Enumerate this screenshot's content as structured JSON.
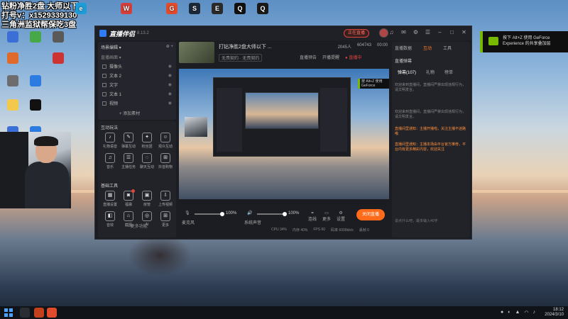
{
  "overlay": {
    "line1": "钻粉净胜2盘 大师以下",
    "line2": "打号v：x1529339130",
    "line3": "三角洲监狱帮保吃3盘"
  },
  "desktop_icons": [
    {
      "label": "Microsoft Edge",
      "color": "#1e9bd7",
      "glyph": "e"
    },
    {
      "label": "WPS",
      "color": "#d43f3a",
      "glyph": "W"
    },
    {
      "label": "Steam",
      "color": "#1b2838",
      "glyph": "S"
    },
    {
      "label": "Epic",
      "color": "#2a2a2a",
      "glyph": "E"
    },
    {
      "label": "QQ",
      "color": "#111111",
      "glyph": "Q"
    },
    {
      "label": "QQ",
      "color": "#1a1a1a",
      "glyph": "Q"
    }
  ],
  "app": {
    "name": "直播伴侣",
    "version": "8.13.2",
    "live_badge": "正在直播",
    "scenes": {
      "header": "场景编辑 ▾",
      "header_right": "⊕ +",
      "sub": "直播画面 ▾",
      "items": [
        "摄像头",
        "文本 2",
        "文字",
        "文本 1",
        "视频"
      ],
      "add_label": "+ 添加素材"
    },
    "interaction": {
      "title": "互动玩法",
      "tools": [
        "礼物语音",
        "弹幕互动",
        "粉丝团",
        "观众互动",
        "音乐",
        "主播任务",
        "聊天互动",
        "抖音购物"
      ]
    },
    "basic_tools": {
      "title": "基础工具",
      "tools": [
        "直播设置",
        "福袋",
        "房管",
        "上传视频",
        "音效",
        "截图",
        "AI",
        "更多"
      ],
      "more": "··· 更多功能"
    },
    "stream": {
      "title": "打钻净胜2盘大师以下 ...",
      "category": "无畏契约 · 无畏契约",
      "actions": [
        "直播预告",
        "开播提醒",
        "● 直播中"
      ],
      "stats": [
        "2045人",
        "604743",
        "00:00"
      ]
    },
    "notif": "按 Alt+Z 使用 GeForce",
    "controls": {
      "mic_label": "麦克风",
      "mic_pct": "100%",
      "sys_label": "系统声音",
      "sys_pct": "100%",
      "btn_labels": [
        "连线",
        "更多",
        "设置"
      ],
      "start_label": "关闭直播",
      "status": [
        "CPU 34%",
        "内存 40%",
        "FPS 60",
        "码率 6000kb/s",
        "丢帧 0"
      ]
    },
    "right": {
      "tabs": [
        "直播数据",
        "互动",
        "工具"
      ],
      "chat_head": "直播弹幕",
      "chat_tabs": [
        "弹幕(107)",
        "礼物",
        "榜单"
      ],
      "messages": [
        {
          "text": "欢迎来到直播间，直播间严禁出现违规行为，请文明发言。",
          "hl": false
        },
        {
          "text": "欢迎来到直播间，直播间严禁出现违规行为，请文明发言。",
          "hl": false
        },
        {
          "text": "直播间里通知：主播开播啦，关注主播不迷路哦",
          "hl": true
        },
        {
          "text": "直播间里通知：主播本场由平台官方推荐，平台内有更多精彩内容，欢迎关注",
          "hl": true
        }
      ],
      "input_hint": "说点什么吧，最多输入40字"
    }
  },
  "nvidia": {
    "text": "按下 Alt+Z 使用 GeForce Experience 的共享叠加层"
  },
  "taskbar": {
    "time": "18:12",
    "date": "2024/3/10"
  }
}
